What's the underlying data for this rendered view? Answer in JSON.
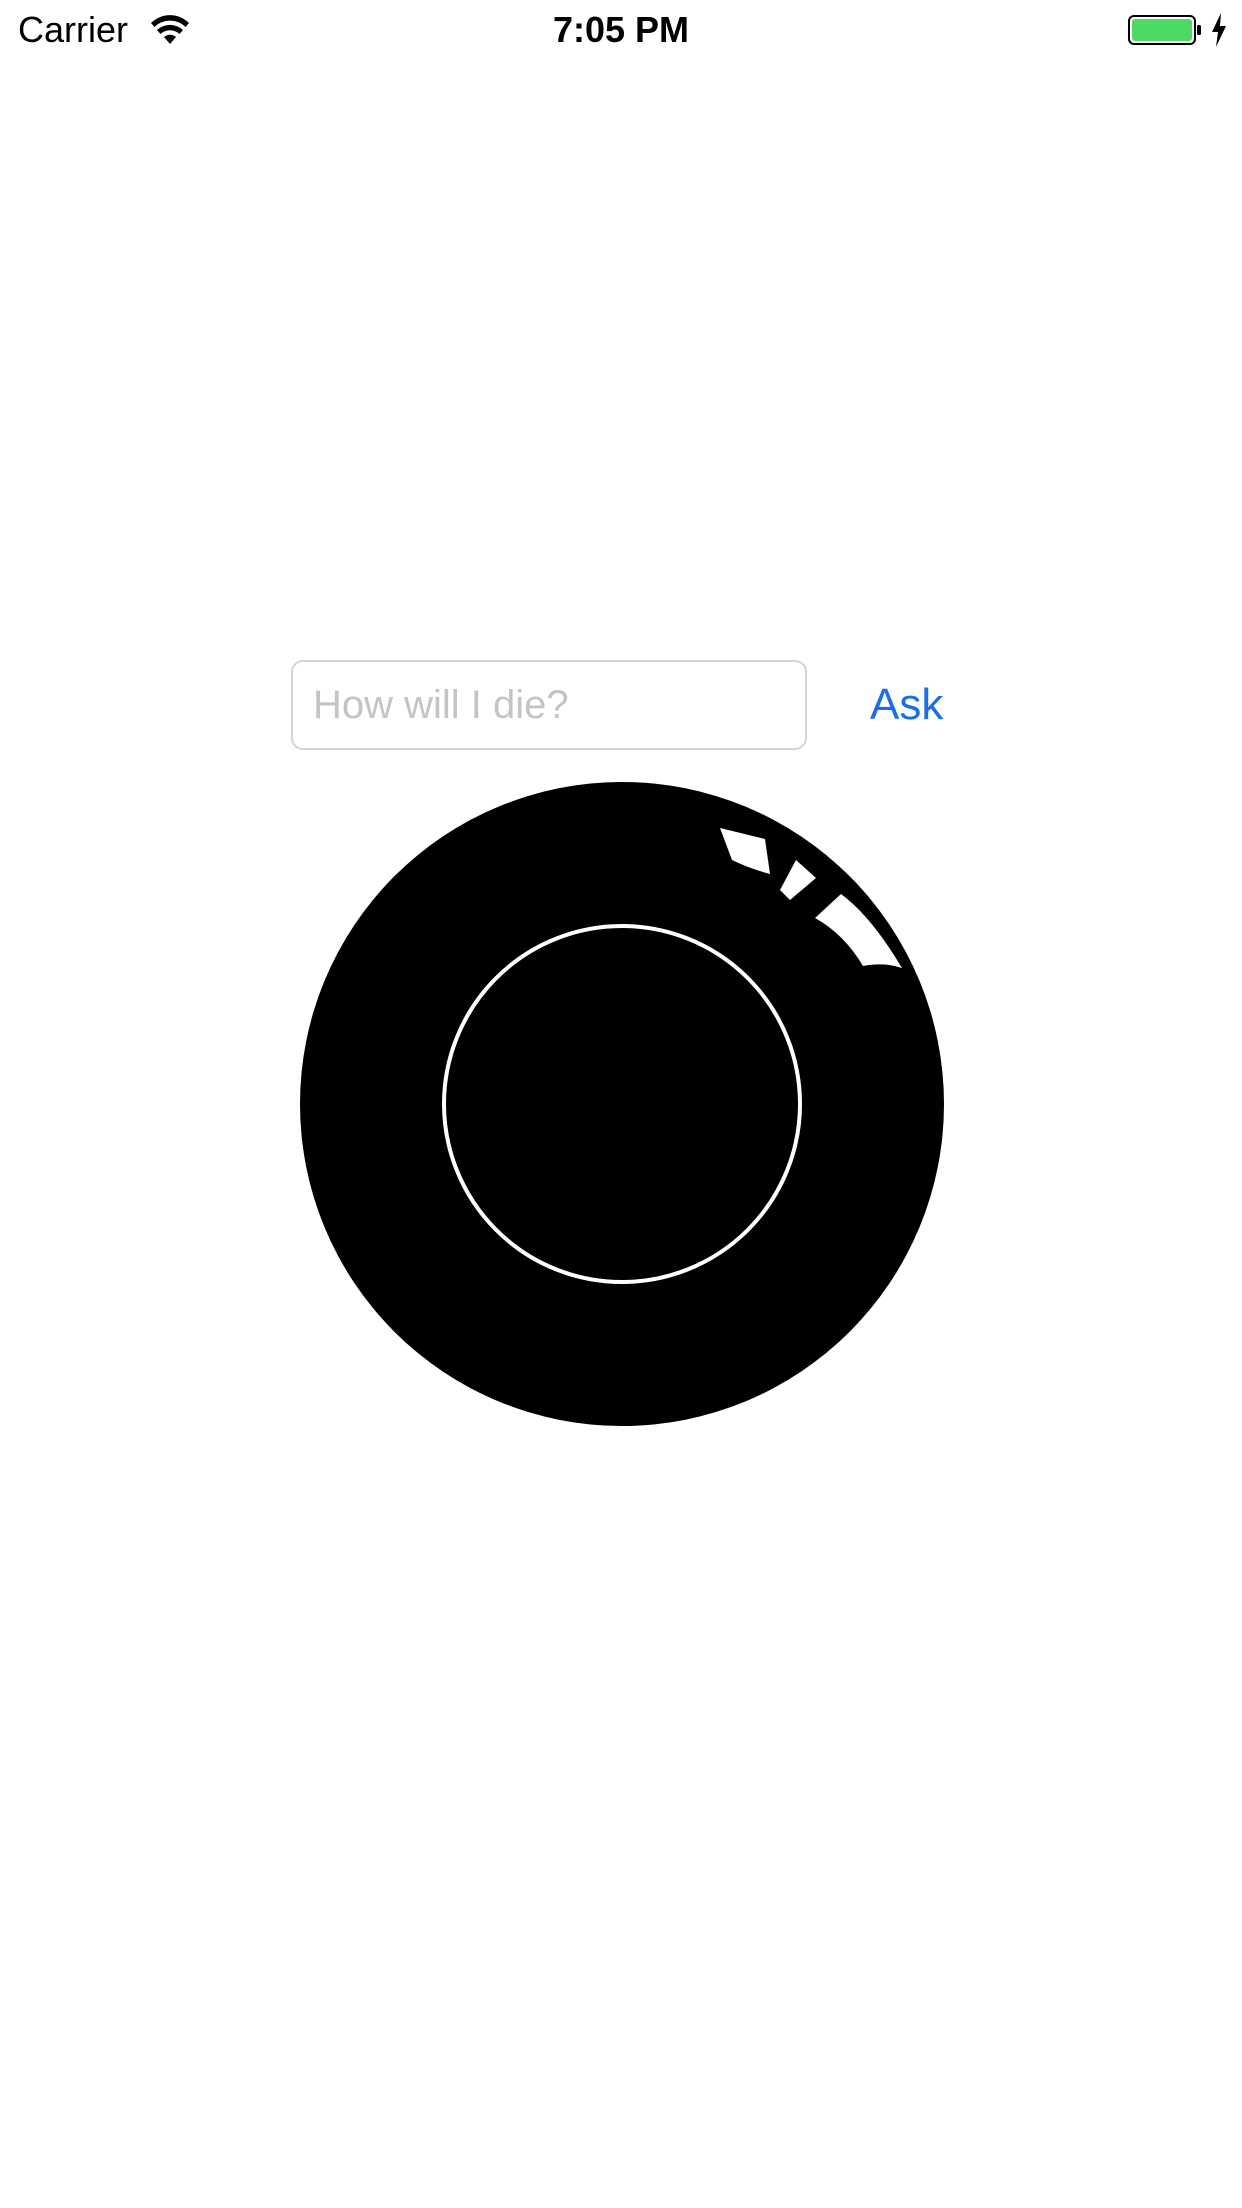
{
  "status_bar": {
    "carrier": "Carrier",
    "time": "7:05 PM",
    "wifi_icon": "wifi-icon",
    "battery_icon": "battery-icon",
    "charging_icon": "bolt-icon",
    "battery_color": "#4cd964"
  },
  "question": {
    "value": "",
    "placeholder": "How will I die?"
  },
  "ask_button": {
    "label": "Ask",
    "color": "#1a6ee6"
  },
  "eight_ball": {
    "icon": "magic-8-ball-icon",
    "ball_color": "#000000",
    "window_ring_color": "#ffffff"
  }
}
